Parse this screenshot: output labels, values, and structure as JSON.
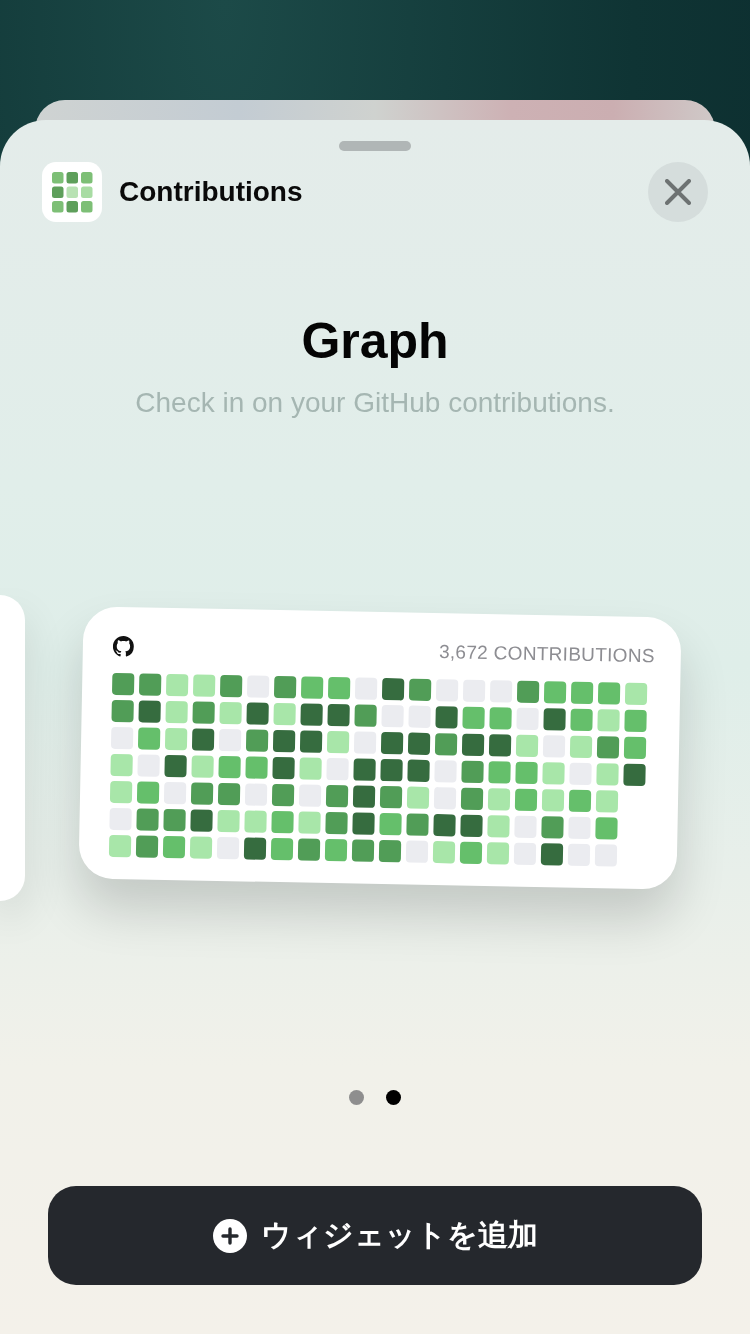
{
  "sheet": {
    "app": {
      "name": "Contributions"
    },
    "title": "Graph",
    "description": "Check in on your GitHub contributions."
  },
  "widget": {
    "count_label": "3,672 CONTRIBUTIONS",
    "weeks": [
      {
        "days": [
          {
            "color": "#519d57"
          },
          {
            "color": "#519d57"
          },
          {
            "color": "#ebecf0"
          },
          {
            "color": "#a8e6a9"
          },
          {
            "color": "#a8e6a9"
          },
          {
            "color": "#ebecf0"
          },
          {
            "color": "#a8e6a9"
          }
        ]
      },
      {
        "days": [
          {
            "color": "#519d57"
          },
          {
            "color": "#366c3f"
          },
          {
            "color": "#65bf6b"
          },
          {
            "color": "#ebecf0"
          },
          {
            "color": "#65bf6b"
          },
          {
            "color": "#519d57"
          },
          {
            "color": "#519d57"
          }
        ]
      },
      {
        "days": [
          {
            "color": "#a8e6a9"
          },
          {
            "color": "#a8e6a9"
          },
          {
            "color": "#a8e6a9"
          },
          {
            "color": "#366c3f"
          },
          {
            "color": "#ebecf0"
          },
          {
            "color": "#519d57"
          },
          {
            "color": "#65bf6b"
          }
        ]
      },
      {
        "days": [
          {
            "color": "#a8e6a9"
          },
          {
            "color": "#519d57"
          },
          {
            "color": "#366c3f"
          },
          {
            "color": "#a8e6a9"
          },
          {
            "color": "#519d57"
          },
          {
            "color": "#366c3f"
          },
          {
            "color": "#a8e6a9"
          }
        ]
      },
      {
        "days": [
          {
            "color": "#519d57"
          },
          {
            "color": "#a8e6a9"
          },
          {
            "color": "#ebecf0"
          },
          {
            "color": "#65bf6b"
          },
          {
            "color": "#519d57"
          },
          {
            "color": "#a8e6a9"
          },
          {
            "color": "#ebecf0"
          }
        ]
      },
      {
        "days": [
          {
            "color": "#ebecf0"
          },
          {
            "color": "#366c3f"
          },
          {
            "color": "#519d57"
          },
          {
            "color": "#65bf6b"
          },
          {
            "color": "#ebecf0"
          },
          {
            "color": "#a8e6a9"
          },
          {
            "color": "#366c3f"
          }
        ]
      },
      {
        "days": [
          {
            "color": "#519d57"
          },
          {
            "color": "#a8e6a9"
          },
          {
            "color": "#366c3f"
          },
          {
            "color": "#366c3f"
          },
          {
            "color": "#519d57"
          },
          {
            "color": "#65bf6b"
          },
          {
            "color": "#65bf6b"
          }
        ]
      },
      {
        "days": [
          {
            "color": "#65bf6b"
          },
          {
            "color": "#366c3f"
          },
          {
            "color": "#366c3f"
          },
          {
            "color": "#a8e6a9"
          },
          {
            "color": "#ebecf0"
          },
          {
            "color": "#a8e6a9"
          },
          {
            "color": "#519d57"
          }
        ]
      },
      {
        "days": [
          {
            "color": "#65bf6b"
          },
          {
            "color": "#366c3f"
          },
          {
            "color": "#a8e6a9"
          },
          {
            "color": "#ebecf0"
          },
          {
            "color": "#519d57"
          },
          {
            "color": "#519d57"
          },
          {
            "color": "#65bf6b"
          }
        ]
      },
      {
        "days": [
          {
            "color": "#ebecf0"
          },
          {
            "color": "#519d57"
          },
          {
            "color": "#ebecf0"
          },
          {
            "color": "#366c3f"
          },
          {
            "color": "#366c3f"
          },
          {
            "color": "#366c3f"
          },
          {
            "color": "#519d57"
          }
        ]
      },
      {
        "days": [
          {
            "color": "#366c3f"
          },
          {
            "color": "#ebecf0"
          },
          {
            "color": "#366c3f"
          },
          {
            "color": "#366c3f"
          },
          {
            "color": "#519d57"
          },
          {
            "color": "#65bf6b"
          },
          {
            "color": "#519d57"
          }
        ]
      },
      {
        "days": [
          {
            "color": "#519d57"
          },
          {
            "color": "#ebecf0"
          },
          {
            "color": "#366c3f"
          },
          {
            "color": "#366c3f"
          },
          {
            "color": "#a8e6a9"
          },
          {
            "color": "#519d57"
          },
          {
            "color": "#ebecf0"
          }
        ]
      },
      {
        "days": [
          {
            "color": "#ebecf0"
          },
          {
            "color": "#366c3f"
          },
          {
            "color": "#519d57"
          },
          {
            "color": "#ebecf0"
          },
          {
            "color": "#ebecf0"
          },
          {
            "color": "#366c3f"
          },
          {
            "color": "#a8e6a9"
          }
        ]
      },
      {
        "days": [
          {
            "color": "#ebecf0"
          },
          {
            "color": "#65bf6b"
          },
          {
            "color": "#366c3f"
          },
          {
            "color": "#519d57"
          },
          {
            "color": "#519d57"
          },
          {
            "color": "#366c3f"
          },
          {
            "color": "#65bf6b"
          }
        ]
      },
      {
        "days": [
          {
            "color": "#ebecf0"
          },
          {
            "color": "#65bf6b"
          },
          {
            "color": "#366c3f"
          },
          {
            "color": "#65bf6b"
          },
          {
            "color": "#a8e6a9"
          },
          {
            "color": "#a8e6a9"
          },
          {
            "color": "#a8e6a9"
          }
        ]
      },
      {
        "days": [
          {
            "color": "#519d57"
          },
          {
            "color": "#ebecf0"
          },
          {
            "color": "#a8e6a9"
          },
          {
            "color": "#65bf6b"
          },
          {
            "color": "#65bf6b"
          },
          {
            "color": "#ebecf0"
          },
          {
            "color": "#ebecf0"
          }
        ]
      },
      {
        "days": [
          {
            "color": "#65bf6b"
          },
          {
            "color": "#366c3f"
          },
          {
            "color": "#ebecf0"
          },
          {
            "color": "#a8e6a9"
          },
          {
            "color": "#a8e6a9"
          },
          {
            "color": "#519d57"
          },
          {
            "color": "#366c3f"
          }
        ]
      },
      {
        "days": [
          {
            "color": "#65bf6b"
          },
          {
            "color": "#65bf6b"
          },
          {
            "color": "#a8e6a9"
          },
          {
            "color": "#ebecf0"
          },
          {
            "color": "#65bf6b"
          },
          {
            "color": "#ebecf0"
          },
          {
            "color": "#ebecf0"
          }
        ]
      },
      {
        "days": [
          {
            "color": "#65bf6b"
          },
          {
            "color": "#a8e6a9"
          },
          {
            "color": "#519d57"
          },
          {
            "color": "#a8e6a9"
          },
          {
            "color": "#a8e6a9"
          },
          {
            "color": "#65bf6b"
          },
          {
            "color": "#ebecf0"
          }
        ]
      },
      {
        "days": [
          {
            "color": "#a8e6a9"
          },
          {
            "color": "#65bf6b"
          },
          {
            "color": "#65bf6b"
          },
          {
            "color": "#366c3f"
          }
        ]
      }
    ]
  },
  "pages": [
    {
      "selected": false
    },
    {
      "selected": true
    }
  ],
  "add_button": {
    "label": "ウィジェットを追加"
  }
}
